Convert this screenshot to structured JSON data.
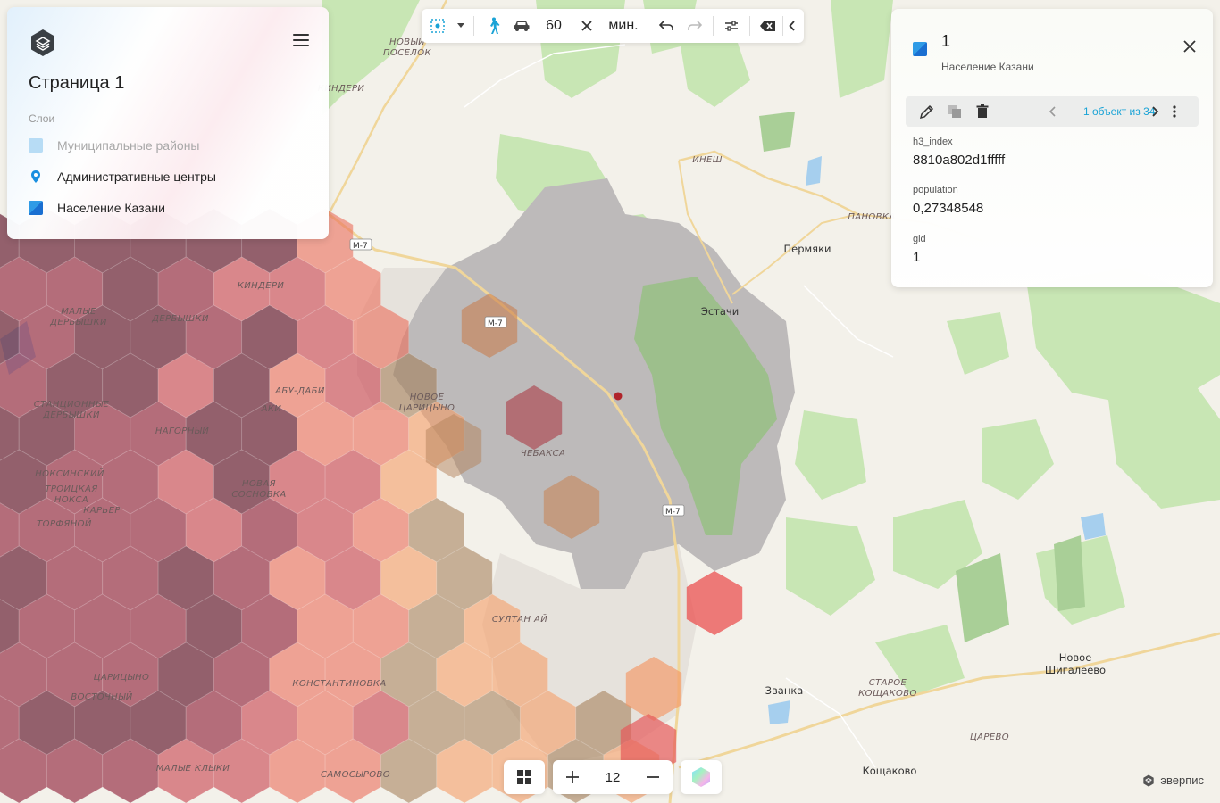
{
  "page": {
    "title": "Страница 1"
  },
  "layers": {
    "section_label": "Слои",
    "items": [
      {
        "label": "Муниципальные районы",
        "icon": "polygon-swatch-icon",
        "color": "#a9d6f5",
        "enabled": false
      },
      {
        "label": "Административные центры",
        "icon": "map-pin-icon",
        "color": "#1a8fe0",
        "enabled": true
      },
      {
        "label": "Население Казани",
        "icon": "polygon-swatch-icon",
        "color": "#1a8fe0",
        "enabled": true
      }
    ]
  },
  "toolbar": {
    "selection_icon": "isochrone-select-icon",
    "walk_icon": "walking-person-icon",
    "car_icon": "car-icon",
    "time_value": "60",
    "multiply_icon": "close-icon",
    "unit_label": "мин.",
    "undo_icon": "undo-icon",
    "redo_icon": "redo-icon",
    "settings_icon": "sliders-icon",
    "clear_icon": "backspace-icon",
    "collapse_icon": "chevron-left-icon",
    "accent_color": "#1aa3d6"
  },
  "info": {
    "title": "1",
    "layer_name": "Население Казани",
    "pager_text": "1 объект из 34",
    "attributes": [
      {
        "key": "h3_index",
        "value": "8810a802d1fffff"
      },
      {
        "key": "population",
        "value": "0,27348548"
      },
      {
        "key": "gid",
        "value": "1"
      }
    ]
  },
  "zoom": {
    "level": "12"
  },
  "brand": {
    "name": "эверпис"
  },
  "map": {
    "labels": {
      "novy_poselok": "НОВЫЙ\nПОСЕЛОК",
      "kinderi_top": "КИНДЕРИ",
      "kinderi": "КИНДЕРИ",
      "malye_derbyshki": "МАЛЫЕ\nДЕРБЫШКИ",
      "derbyshki": "ДЕРБЫШКИ",
      "abu_dabi": "АБУ-ДАБИ",
      "aki": "АКИ",
      "stantsionnye": "СТАНЦИОННЫЕ\nДЕРБЫШКИ",
      "nagorny": "НАГОРНЫЙ",
      "noksinsky": "НОКСИНСКИЙ",
      "troitskaya": "ТРОИЦКАЯ\nНОКСА",
      "karer": "КАРЬЕР",
      "torfyanoy": "ТОРФЯНОЙ",
      "novaya_sosnovka": "НОВАЯ\nСОСНОВКА",
      "novoe_tsaritsyno": "НОВОЕ\nЦАРИЦЫНО",
      "chebaksa": "ЧЕБАКСА",
      "sultan_ay": "СУЛТАН АЙ",
      "tsaritsyno": "ЦАРИЦЫНО",
      "vostochny": "ВОСТОЧНЫЙ",
      "konstantinovka": "КОНСТАНТИНОВКА",
      "malye_klyki": "МАЛЫЕ КЛЫКИ",
      "samosyrovo": "САМОСЫРОВО",
      "inesh": "ИНЕШ",
      "panovka": "ПАНОВКА",
      "permyaki": "Пермяки",
      "estachi": "Эстачи",
      "zvanka": "Званка",
      "staroe_koshchakovo": "СТАРОЕ\nКОЩАКОВО",
      "tsarevo": "ЦАРЕВО",
      "koshchakovo": "Кощаково",
      "novoe_shigaleevo": "Новое\nШигалеево"
    },
    "road_m7": "М-7",
    "marker_color": "#b0242a"
  }
}
